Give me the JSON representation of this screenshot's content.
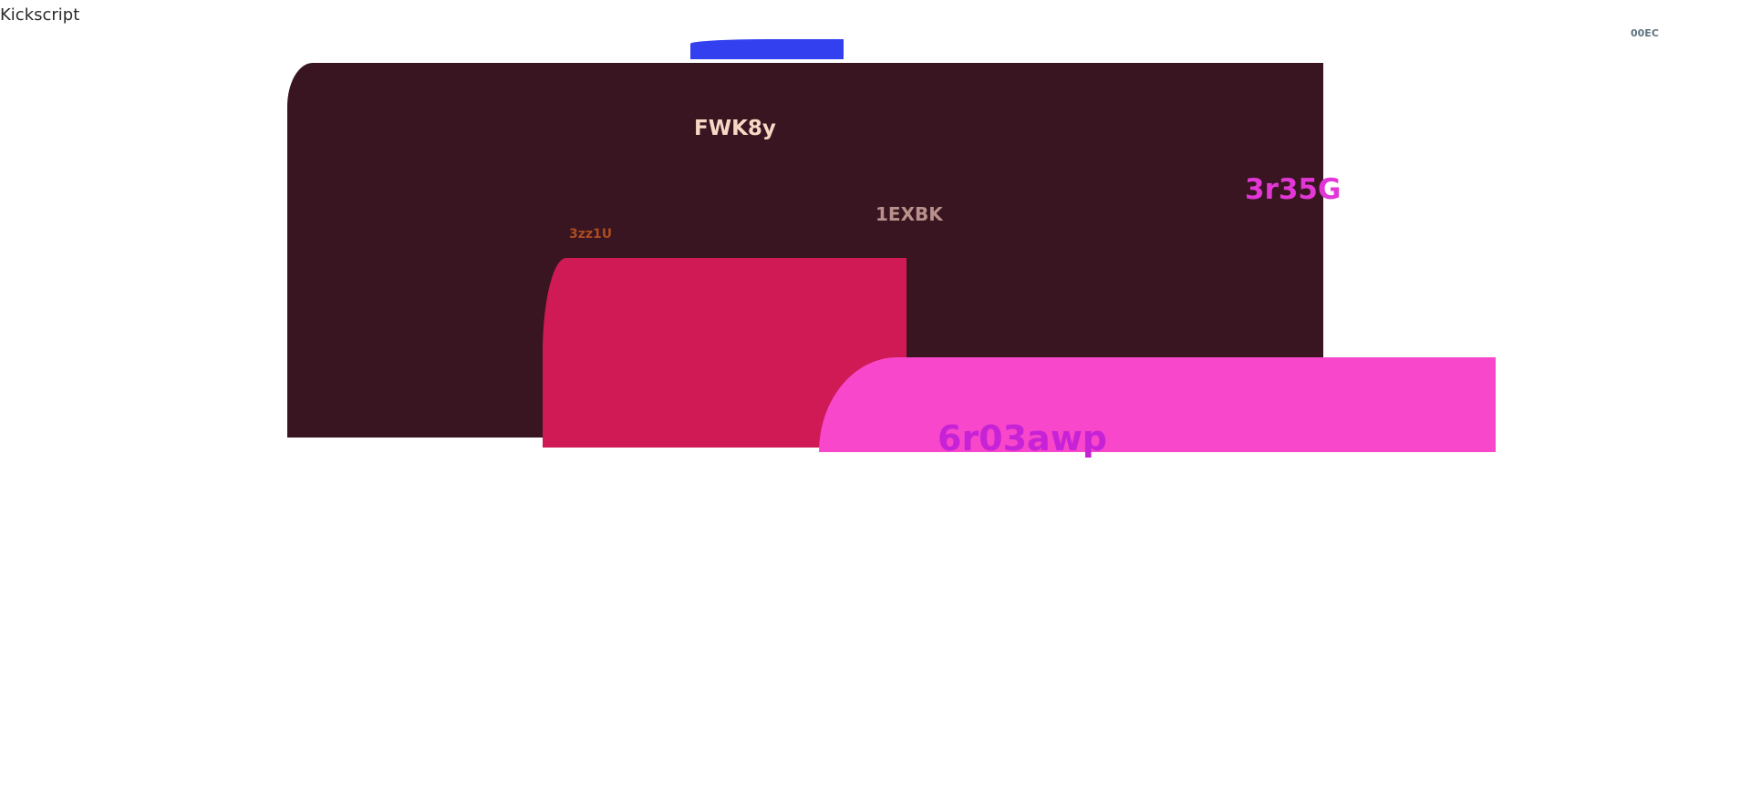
{
  "top_left_text": "Kickscript",
  "blocks": {
    "blue": {
      "color": "#3340f0"
    },
    "maroon": {
      "color": "#381520"
    },
    "crimson": {
      "color": "#cf1a55"
    },
    "pink": {
      "color": "#f847cb"
    }
  },
  "labels": {
    "fwk8y": "FWK8y",
    "exbk": "1EXBK",
    "r35g": "3r35G",
    "zz1u": "3zz1U",
    "r03awp": "6r03awp",
    "ec00": "00EC"
  }
}
